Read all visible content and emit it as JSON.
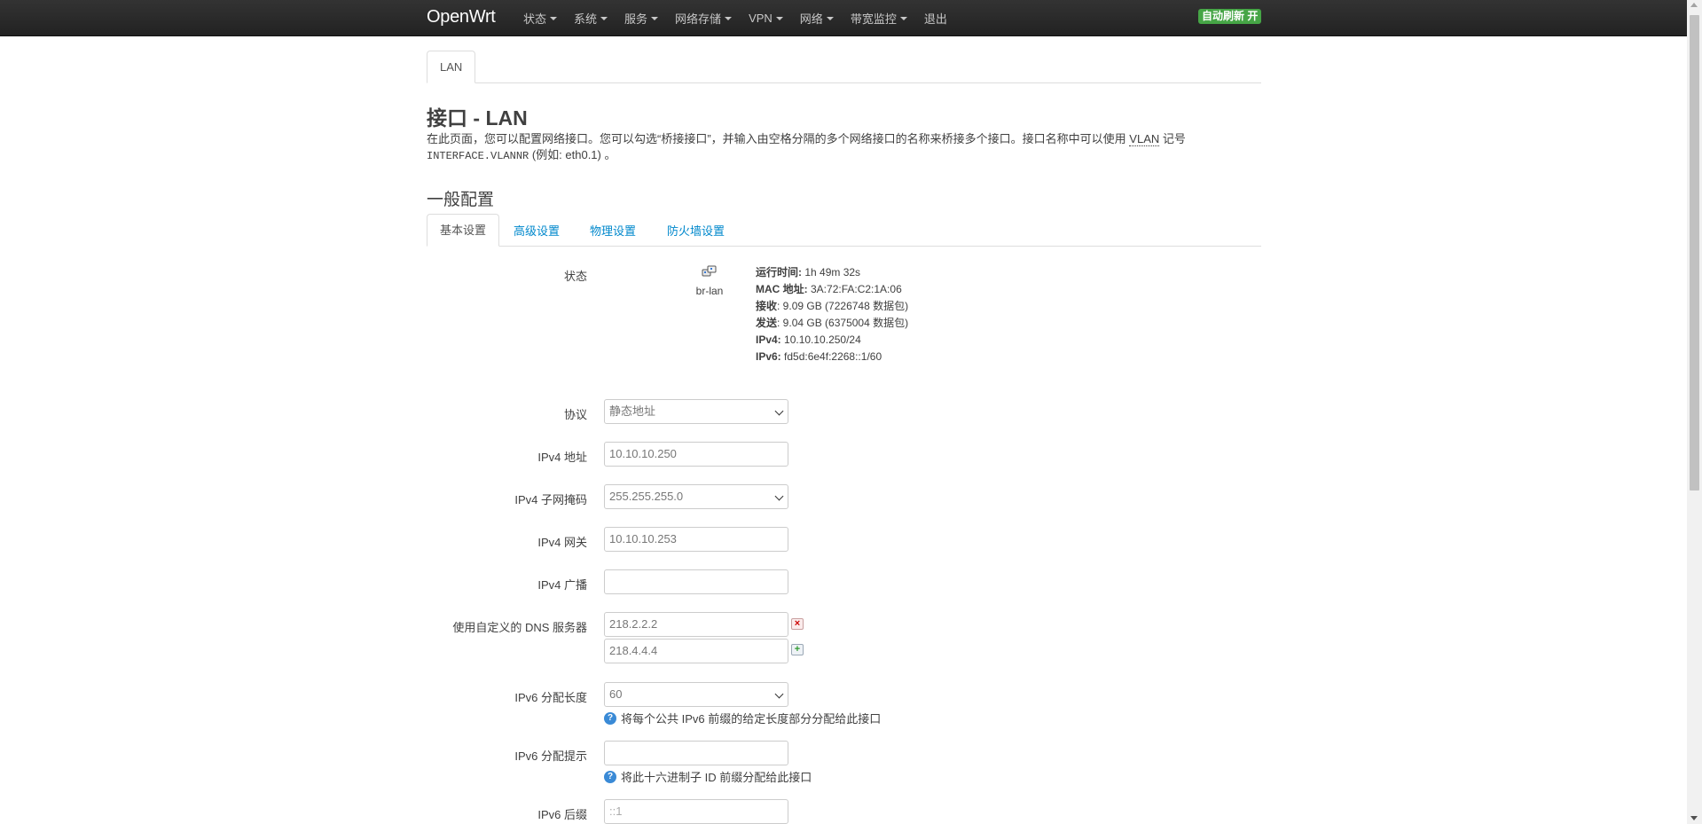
{
  "navbar": {
    "brand": "OpenWrt",
    "menu": [
      "状态",
      "系统",
      "服务",
      "网络存储",
      "VPN",
      "网络",
      "带宽监控",
      "退出"
    ],
    "auto_refresh": "自动刷新 开"
  },
  "colors": {
    "navbar": "#222222",
    "link": "#0088cc",
    "badge": "#46a546"
  },
  "main": {
    "tab": "LAN",
    "title": "接口 - LAN",
    "desc_line1": "在此页面，您可以配置网络接口。您可以勾选“桥接接口”，并输入由空格分隔的多个网络接口的名称来桥接多个接口。接口名称中可以使用",
    "desc_vlan": "VLAN",
    "desc_after_vlan": "记号",
    "desc_code": "INTERFACE.VLANNR",
    "desc_line2_tail": "(例如: eth0.1) 。",
    "section_title": "一般配置",
    "subtabs": [
      "基本设置",
      "高级设置",
      "物理设置",
      "防火墙设置"
    ]
  },
  "status": {
    "label": "状态",
    "iface_name": "br-lan",
    "uptime_label": "运行时间:",
    "uptime_value": " 1h 49m 32s",
    "mac_label": "MAC 地址:",
    "mac_value": " 3A:72:FA:C2:1A:06",
    "rx_label": "接收",
    "rx_value": ": 9.09 GB (7226748 数据包)",
    "tx_label": "发送",
    "tx_value": ": 9.04 GB (6375004 数据包)",
    "ipv4_label": "IPv4:",
    "ipv4_value": " 10.10.10.250/24",
    "ipv6_label": "IPv6:",
    "ipv6_value": " fd5d:6e4f:2268::1/60"
  },
  "form": {
    "protocol_label": "协议",
    "protocol_value": "静态地址",
    "ipv4_addr_label": "IPv4 地址",
    "ipv4_addr_value": "10.10.10.250",
    "ipv4_mask_label": "IPv4 子网掩码",
    "ipv4_mask_value": "255.255.255.0",
    "ipv4_gw_label": "IPv4 网关",
    "ipv4_gw_value": "10.10.10.253",
    "ipv4_bcast_label": "IPv4 广播",
    "ipv4_bcast_value": "",
    "dns_label": "使用自定义的 DNS 服务器",
    "dns_values": [
      "218.2.2.2",
      "218.4.4.4"
    ],
    "ipv6_assign_len_label": "IPv6 分配长度",
    "ipv6_assign_len_value": "60",
    "ipv6_assign_len_help": "将每个公共 IPv6 前缀的给定长度部分分配给此接口",
    "ipv6_assign_hint_label": "IPv6 分配提示",
    "ipv6_assign_hint_value": "",
    "ipv6_assign_hint_help": "将此十六进制子 ID 前缀分配给此接口",
    "ipv6_suffix_label": "IPv6 后缀",
    "ipv6_suffix_placeholder": "::1"
  }
}
